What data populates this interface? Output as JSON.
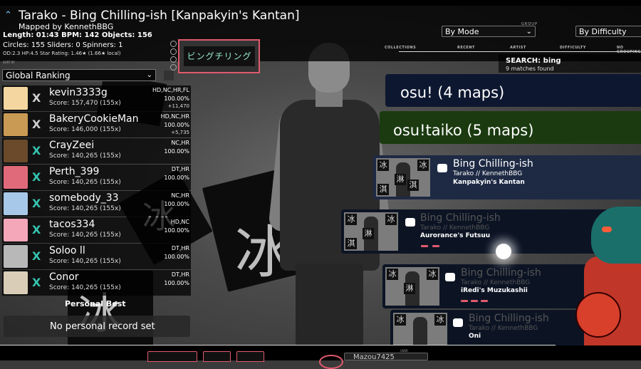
{
  "beatmap": {
    "title": "Tarako - Bing Chilling-ish [Kanpakyin's Kantan]",
    "mapper": "Mapped by KennethBBG",
    "stats_line1": "Length: 01:43 BPM: 142 Objects: 156",
    "stats_line2": "Circles: 155 Sliders: 0 Spinners: 1",
    "stats_line3": "OD:2.3 HP:4.5 Star Rating: 1.46★ (1.66★ local)"
  },
  "thumbnail_text": "ビングチリング",
  "ranking": {
    "label": "SORT BY",
    "selected": "Global Ranking"
  },
  "group": {
    "label": "GROUP",
    "selected": "By Mode"
  },
  "sort": {
    "selected": "By Difficulty"
  },
  "sort_tabs": [
    "COLLECTIONS",
    "RECENT",
    "ARTIST",
    "DIFFICULTY",
    "NO GROUPING"
  ],
  "search": {
    "label": "SEARCH: bing",
    "matches": "9 matches found"
  },
  "leaderboard": [
    {
      "grade": "X",
      "name": "kevin3333g",
      "score": "Score: 157,470 (155x)",
      "mods": "HD,NC,HR,FL",
      "accuracy": "100.00%",
      "pp": "+11,470",
      "avatar_color": "#f4d7a0",
      "grade_color": "#d0d0d0"
    },
    {
      "grade": "X",
      "name": "BakeryCookieMan",
      "score": "Score: 146,000 (155x)",
      "mods": "HD,NC,HR",
      "accuracy": "100.00%",
      "pp": "+5,735",
      "avatar_color": "#c99a54",
      "grade_color": "#d0d0d0"
    },
    {
      "grade": "X",
      "name": "CrayZeei",
      "score": "Score: 140,265 (155x)",
      "mods": "NC,HR",
      "accuracy": "100.00%",
      "pp": "",
      "avatar_color": "#6a4a2a",
      "grade_color": "#35c4b0"
    },
    {
      "grade": "X",
      "name": "Perth_399",
      "score": "Score: 140,265 (155x)",
      "mods": "DT,HR",
      "accuracy": "100.00%",
      "pp": "",
      "avatar_color": "#e06a7a",
      "grade_color": "#35c4b0"
    },
    {
      "grade": "X",
      "name": "somebody_33",
      "score": "Score: 140,265 (155x)",
      "mods": "NC,HR",
      "accuracy": "100.00%",
      "pp": "",
      "avatar_color": "#a7c8e8",
      "grade_color": "#35c4b0"
    },
    {
      "grade": "X",
      "name": "tacos334",
      "score": "Score: 140,265 (155x)",
      "mods": "HD,NC",
      "accuracy": "100.00%",
      "pp": "",
      "avatar_color": "#f3a7b8",
      "grade_color": "#35c4b0"
    },
    {
      "grade": "X",
      "name": "Soloo ll",
      "score": "Score: 140,265 (155x)",
      "mods": "DT,HR",
      "accuracy": "100.00%",
      "pp": "",
      "avatar_color": "#b8b8b8",
      "grade_color": "#35c4b0"
    },
    {
      "grade": "X",
      "name": "Conor",
      "score": "Score: 140,265 (155x)",
      "mods": "DT,HR",
      "accuracy": "100.00%",
      "pp": "",
      "avatar_color": "#d9cdb8",
      "grade_color": "#35c4b0"
    }
  ],
  "personal_best": {
    "label": "Personal Best",
    "text": "No personal record set"
  },
  "groups": [
    {
      "label": "osu! (4 maps)"
    },
    {
      "label": "osu!taiko (5 maps)"
    }
  ],
  "maps": [
    {
      "title": "Bing Chilling-ish",
      "artist": "Tarako // KennethBBG",
      "difficulty": "Kanpakyin's Kantan",
      "selected": true
    },
    {
      "title": "Bing Chilling-ish",
      "artist": "Tarako // KennethBBG",
      "difficulty": "Aurorance's Futsuu",
      "selected": false
    },
    {
      "title": "Bing Chilling-ish",
      "artist": "Tarako // KennethBBG",
      "difficulty": "iRedi's Muzukashii",
      "selected": false
    },
    {
      "title": "Bing Chilling-ish",
      "artist": "Tarako // KennethBBG",
      "difficulty": "Oni",
      "selected": false
    }
  ],
  "thumb_glyphs": [
    "冰",
    "淇",
    "淋",
    "冰"
  ],
  "user": {
    "label": "USER",
    "name": "Mazou7425"
  },
  "colors": {
    "accent_pink": "#e05a6d",
    "grade_x_teal": "#35c4b0",
    "selected_card": "#1e2a44",
    "unselected_card": "#0c1424"
  }
}
